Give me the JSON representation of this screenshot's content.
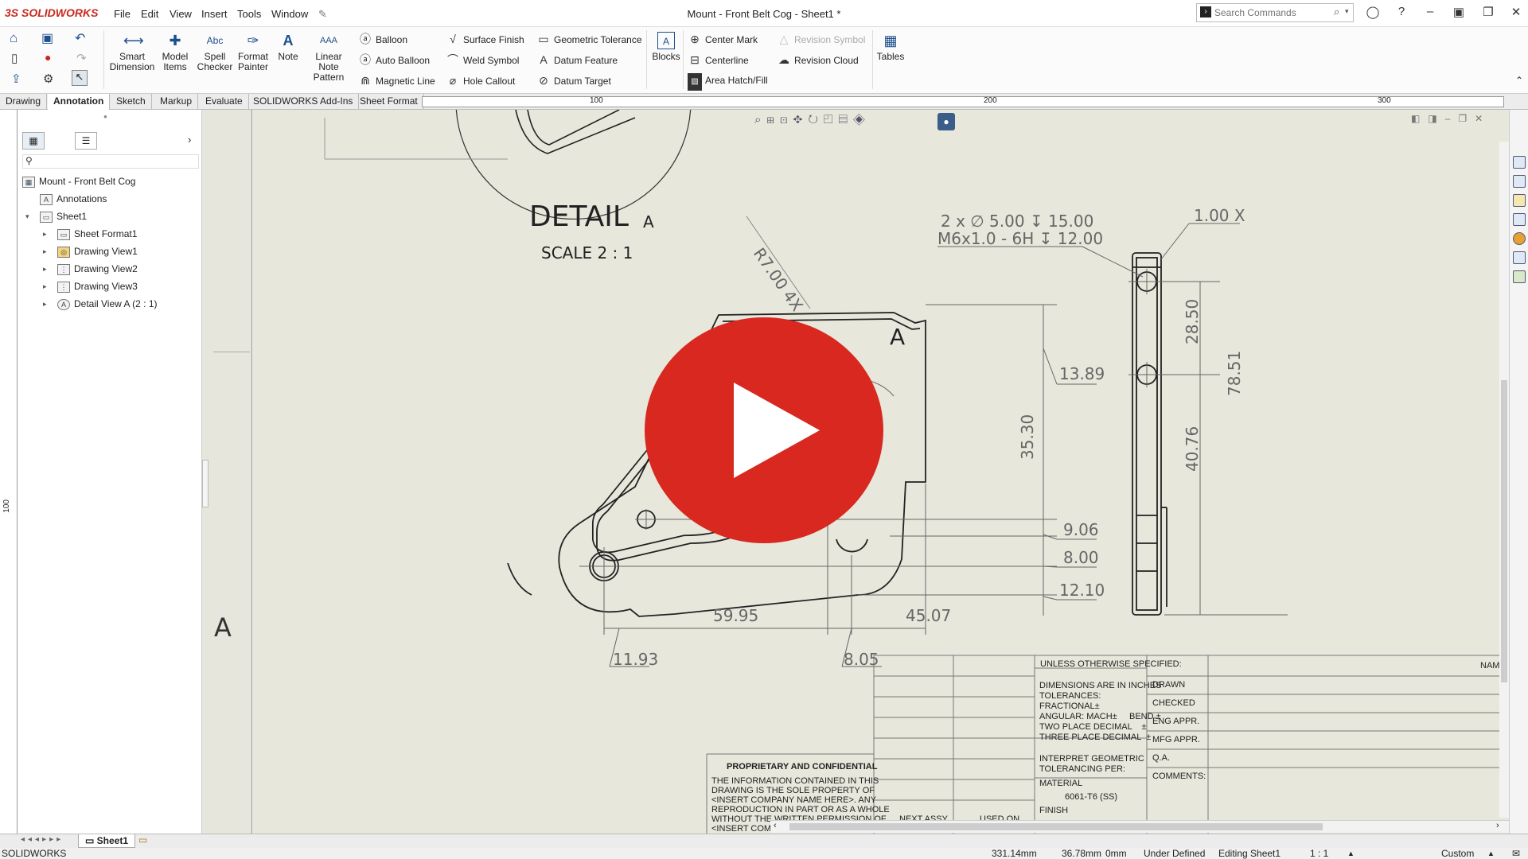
{
  "app": {
    "name": "SOLIDWORKS",
    "doc_title": "Mount - Front Belt Cog - Sheet1 *"
  },
  "menu": [
    "File",
    "Edit",
    "View",
    "Insert",
    "Tools",
    "Window"
  ],
  "search": {
    "placeholder": "Search Commands"
  },
  "ribbon": {
    "smart_dimension": "Smart Dimension",
    "model_items": "Model Items",
    "spell_checker": "Spell Checker",
    "format_painter": "Format Painter",
    "note": "Note",
    "linear_note_pattern": "Linear Note Pattern",
    "balloon": "Balloon",
    "auto_balloon": "Auto Balloon",
    "magnetic_line": "Magnetic Line",
    "surface_finish": "Surface Finish",
    "weld_symbol": "Weld Symbol",
    "hole_callout": "Hole Callout",
    "geometric_tolerance": "Geometric Tolerance",
    "datum_feature": "Datum Feature",
    "datum_target": "Datum Target",
    "blocks": "Blocks",
    "center_mark": "Center Mark",
    "centerline": "Centerline",
    "area_hatch_fill": "Area Hatch/Fill",
    "revision_symbol": "Revision Symbol",
    "revision_cloud": "Revision Cloud",
    "tables": "Tables"
  },
  "tabs": [
    "Drawing",
    "Annotation",
    "Sketch",
    "Markup",
    "Evaluate",
    "SOLIDWORKS Add-Ins",
    "Sheet Format"
  ],
  "active_tab": "Annotation",
  "ruler": {
    "marks": [
      "100",
      "200",
      "300"
    ],
    "vmark": "100"
  },
  "tree": {
    "root": "Mount - Front Belt Cog",
    "annotations": "Annotations",
    "sheet": "Sheet1",
    "children": [
      "Sheet Format1",
      "Drawing View1",
      "Drawing View2",
      "Drawing View3",
      "Detail View A (2 : 1)"
    ]
  },
  "drawing": {
    "detail_title": "DETAIL",
    "detail_letter": "A",
    "scale": "SCALE 2 : 1",
    "radius_callout": "R7.00 4X",
    "section_letter": "A",
    "gutter_letter": "A",
    "dims": {
      "d1389": "13.89",
      "d3530": "35.30",
      "d906": "9.06",
      "d800": "8.00",
      "d1210": "12.10",
      "d5995": "59.95",
      "d4507": "45.07",
      "d1193": "11.93",
      "d805": "8.05",
      "d2850": "28.50",
      "d4076": "40.76",
      "d7851": "78.51",
      "d100": "1.00 X"
    },
    "hole_callout_line1": "2 x ∅ 5.00 ↧ 15.00",
    "hole_callout_line2": "M6x1.0 - 6H ↧ 12.00"
  },
  "title_block": {
    "unless": "UNLESS OTHERWISE SPECIFIED:",
    "name": "NAME",
    "dims_in": "DIMENSIONS ARE IN INCHES",
    "tolerances": "TOLERANCES:",
    "fractional": "FRACTIONAL±",
    "angular": "ANGULAR: MACH±     BEND ±",
    "two_place": "TWO PLACE DECIMAL    ±",
    "three_place": "THREE PLACE DECIMAL  ±",
    "interpret": "INTERPRET GEOMETRIC",
    "tolerancing": "TOLERANCING PER:",
    "material_label": "MATERIAL",
    "material": "6061-T6 (SS)",
    "finish": "FINISH",
    "drawn": "DRAWN",
    "checked": "CHECKED",
    "eng_appr": "ENG APPR.",
    "mfg_appr": "MFG APPR.",
    "qa": "Q.A.",
    "comments": "COMMENTS:",
    "next_assy": "NEXT ASSY",
    "used_on": "USED ON",
    "proprietary": "PROPRIETARY AND CONFIDENTIAL",
    "prop_lines": [
      "THE INFORMATION CONTAINED IN THIS",
      "DRAWING IS THE SOLE PROPERTY OF",
      "<INSERT COMPANY NAME HERE>.  ANY",
      "REPRODUCTION IN PART OR AS A WHOLE",
      "WITHOUT THE WRITTEN PERMISSION OF",
      "<INSERT COMPANY NAME HERE> IS"
    ]
  },
  "sheet_tab": "Sheet1",
  "status": {
    "app": "SOLIDWORKS",
    "x": "331.14mm",
    "y": "36.78mm",
    "z": "0mm",
    "state": "Under Defined",
    "editing": "Editing Sheet1",
    "scale": "1 : 1",
    "units": "Custom"
  },
  "colors": {
    "play": "#d9281f",
    "canvas": "#e8e7dc",
    "brand": "#c8281e"
  }
}
